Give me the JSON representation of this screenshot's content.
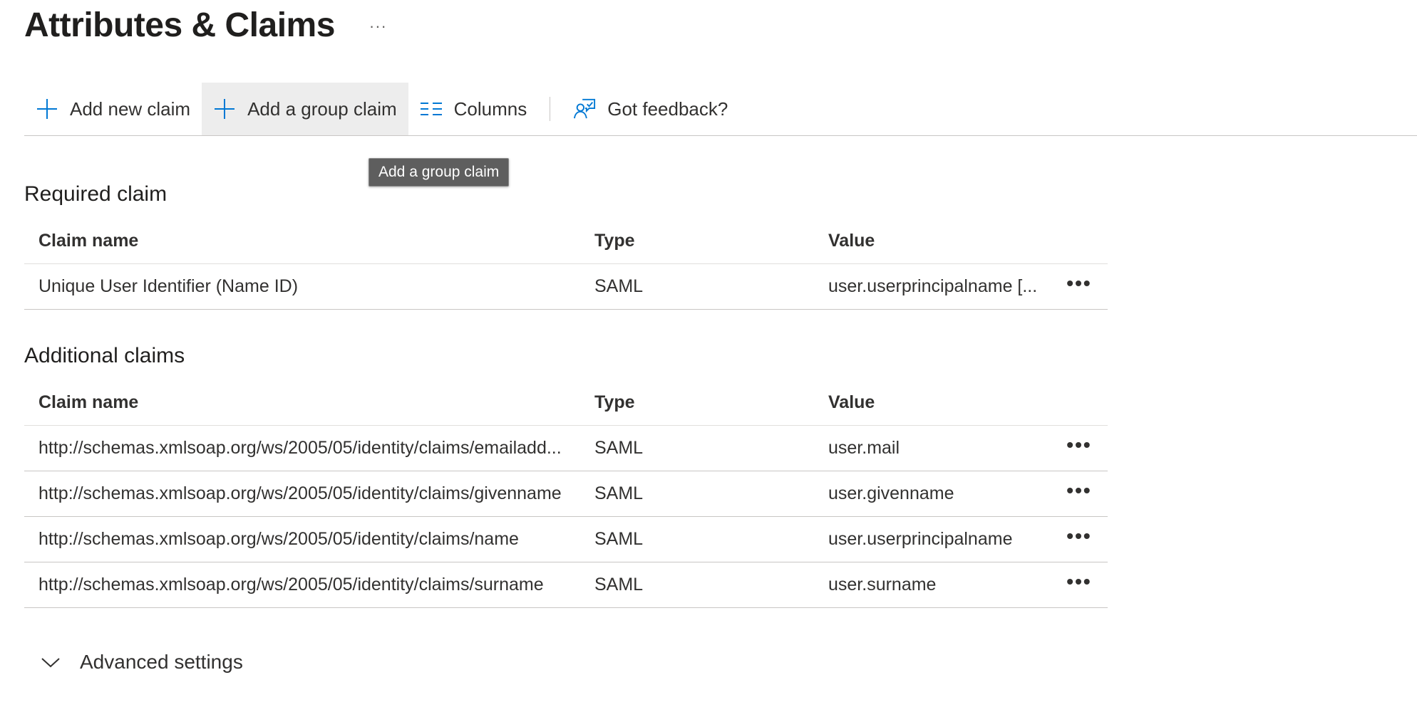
{
  "page": {
    "title": "Attributes & Claims",
    "more_glyph": "···"
  },
  "toolbar": {
    "add_new_claim": "Add new claim",
    "add_group_claim": "Add a group claim",
    "columns": "Columns",
    "feedback": "Got feedback?"
  },
  "tooltip": {
    "text": "Add a group claim"
  },
  "required": {
    "title": "Required claim",
    "headers": {
      "name": "Claim name",
      "type": "Type",
      "value": "Value"
    },
    "rows": [
      {
        "name": "Unique User Identifier (Name ID)",
        "type": "SAML",
        "value": "user.userprincipalname [..."
      }
    ]
  },
  "additional": {
    "title": "Additional claims",
    "headers": {
      "name": "Claim name",
      "type": "Type",
      "value": "Value"
    },
    "rows": [
      {
        "name": "http://schemas.xmlsoap.org/ws/2005/05/identity/claims/emailadd...",
        "type": "SAML",
        "value": "user.mail"
      },
      {
        "name": "http://schemas.xmlsoap.org/ws/2005/05/identity/claims/givenname",
        "type": "SAML",
        "value": "user.givenname"
      },
      {
        "name": "http://schemas.xmlsoap.org/ws/2005/05/identity/claims/name",
        "type": "SAML",
        "value": "user.userprincipalname"
      },
      {
        "name": "http://schemas.xmlsoap.org/ws/2005/05/identity/claims/surname",
        "type": "SAML",
        "value": "user.surname"
      }
    ]
  },
  "row_more_glyph": "•••",
  "advanced": {
    "label": "Advanced settings"
  },
  "colors": {
    "accent": "#0078d4",
    "text": "#323130",
    "hover": "#ededed",
    "tooltip_bg": "#5e5e5e"
  },
  "icons": {
    "add_new_claim": "plus-icon",
    "add_group_claim": "plus-icon",
    "columns": "columns-icon",
    "feedback": "feedback-icon",
    "advanced": "chevron-down-icon"
  }
}
